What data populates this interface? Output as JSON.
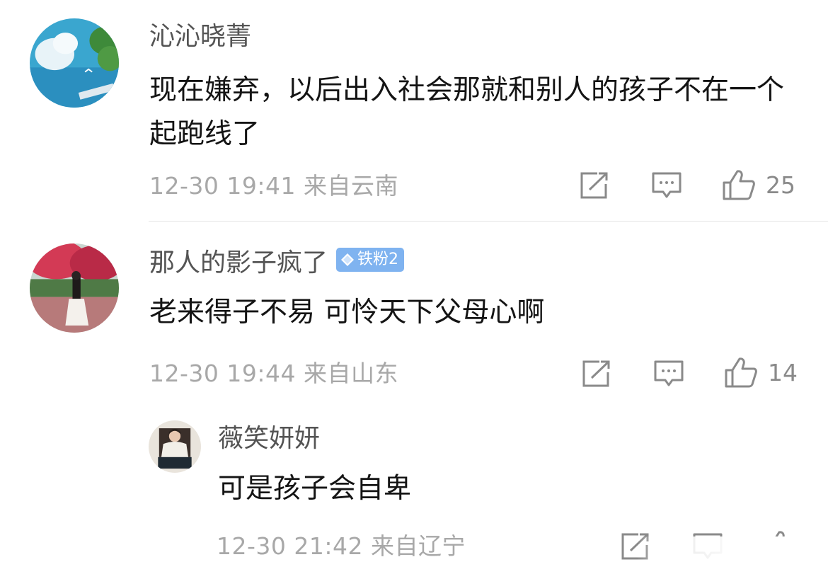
{
  "comments": [
    {
      "username": "沁沁晓菁",
      "text": "现在嫌弃，以后出入社会那就和别人的孩子不在一个起跑线了",
      "meta": "12-30 19:41 来自云南",
      "likes": "25",
      "avatar_icon": "sea-island-avatar"
    },
    {
      "username": "那人的影子疯了",
      "badge": "铁粉2",
      "text": "老来得子不易 可怜天下父母心啊",
      "meta": "12-30 19:44 来自山东",
      "likes": "14",
      "avatar_icon": "girl-flowers-avatar"
    }
  ],
  "reply": {
    "username": "薇笑妍妍",
    "text": "可是孩子会自卑",
    "meta": "12-30 21:42 来自辽宁",
    "avatar_icon": "woman-sitting-avatar"
  },
  "icons": {
    "share": "share-icon",
    "comment": "comment-icon",
    "like": "thumbs-up-icon"
  },
  "colors": {
    "badge": "#7fb3f0",
    "meta_text": "#a8a8a8",
    "username_text": "#545454"
  }
}
